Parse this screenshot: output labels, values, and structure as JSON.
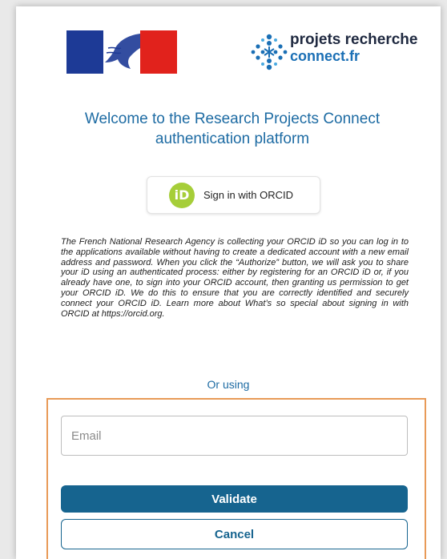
{
  "header": {
    "brand_line1": "projets recherche",
    "brand_line2": "connect.fr",
    "flag_logo_icon": "marianne-flag-logo",
    "brand_logo_icon": "dotted-asterisk-logo"
  },
  "welcome": {
    "line1": "Welcome to the Research Projects Connect",
    "line2": "authentication platform"
  },
  "orcid": {
    "icon_text": "iD",
    "label": "Sign in with ORCID",
    "icon_color": "#a6ce39"
  },
  "disclaimer": "The French National Research Agency is collecting your ORCID iD so you can log in to the applications available without having to create a dedicated account with a new email address and password. When you click the “Authorize” button, we will ask you to share your iD using an authenticated process: either by registering for an ORCID iD or, if you already have one, to sign into your ORCID account, then granting us permission to get your ORCID iD. We do this to ensure that you are correctly identified and securely connect your ORCID iD. Learn more about What’s so special about signing in with ORCID at https://orcid.org.",
  "alt_login": {
    "or_using": "Or using",
    "email_placeholder": "Email",
    "email_value": "",
    "validate_label": "Validate",
    "cancel_label": "Cancel"
  },
  "colors": {
    "accent": "#16648f",
    "title": "#1d6ba3",
    "highlight": "#e89a57"
  }
}
